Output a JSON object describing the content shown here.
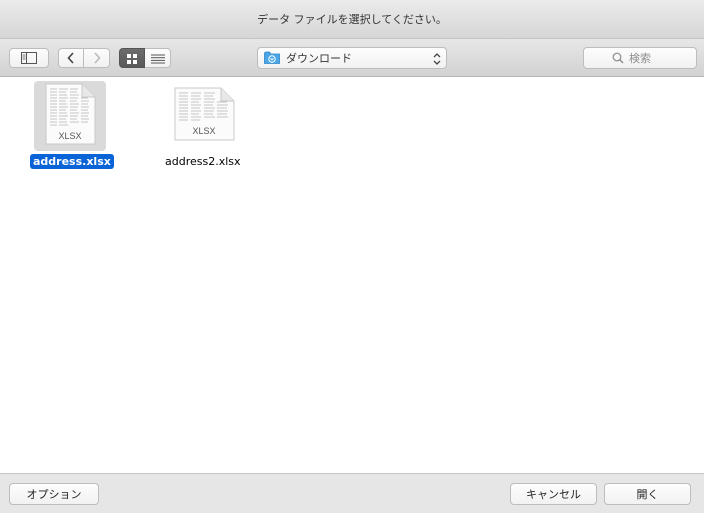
{
  "window": {
    "title": "データ ファイルを選択してください。"
  },
  "toolbar": {
    "location_label": "ダウンロード",
    "search_placeholder": "検索",
    "view_mode": "icon"
  },
  "files": [
    {
      "name": "address.xlsx",
      "type_label": "XLSX",
      "selected": true
    },
    {
      "name": "address2.xlsx",
      "type_label": "XLSX",
      "selected": false
    }
  ],
  "bottom": {
    "options_label": "オプション",
    "cancel_label": "キャンセル",
    "open_label": "開く"
  },
  "colors": {
    "selection": "#0a64d8",
    "folder": "#4aa6e8"
  }
}
